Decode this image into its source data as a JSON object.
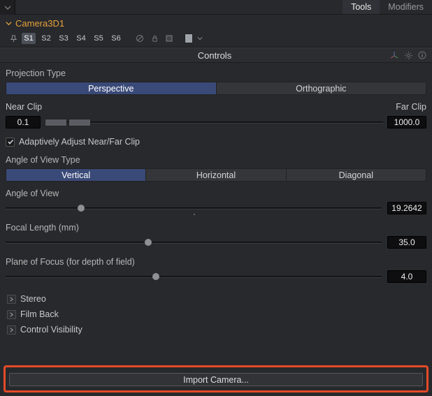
{
  "top_tabs": {
    "tools": "Tools",
    "modifiers": "Modifiers"
  },
  "node": {
    "name": "Camera3D1"
  },
  "states": [
    "S1",
    "S2",
    "S3",
    "S4",
    "S5",
    "S6"
  ],
  "section_title": "Controls",
  "projection": {
    "label": "Projection Type",
    "options": [
      "Perspective",
      "Orthographic"
    ],
    "selected": 0
  },
  "clip": {
    "near_label": "Near Clip",
    "far_label": "Far Clip",
    "near": "0.1",
    "far": "1000.0"
  },
  "adaptive": {
    "checked": true,
    "label": "Adaptively Adjust Near/Far Clip"
  },
  "aov_type": {
    "label": "Angle of View Type",
    "options": [
      "Vertical",
      "Horizontal",
      "Diagonal"
    ],
    "selected": 0
  },
  "aov": {
    "label": "Angle of View",
    "value": "19.2642",
    "pos": 20
  },
  "focal": {
    "label": "Focal Length (mm)",
    "value": "35.0",
    "pos": 38
  },
  "pof": {
    "label": "Plane of Focus (for depth of field)",
    "value": "4.0",
    "pos": 40
  },
  "sections": {
    "stereo": "Stereo",
    "filmback": "Film Back",
    "ctrlvis": "Control Visibility"
  },
  "import_label": "Import Camera..."
}
